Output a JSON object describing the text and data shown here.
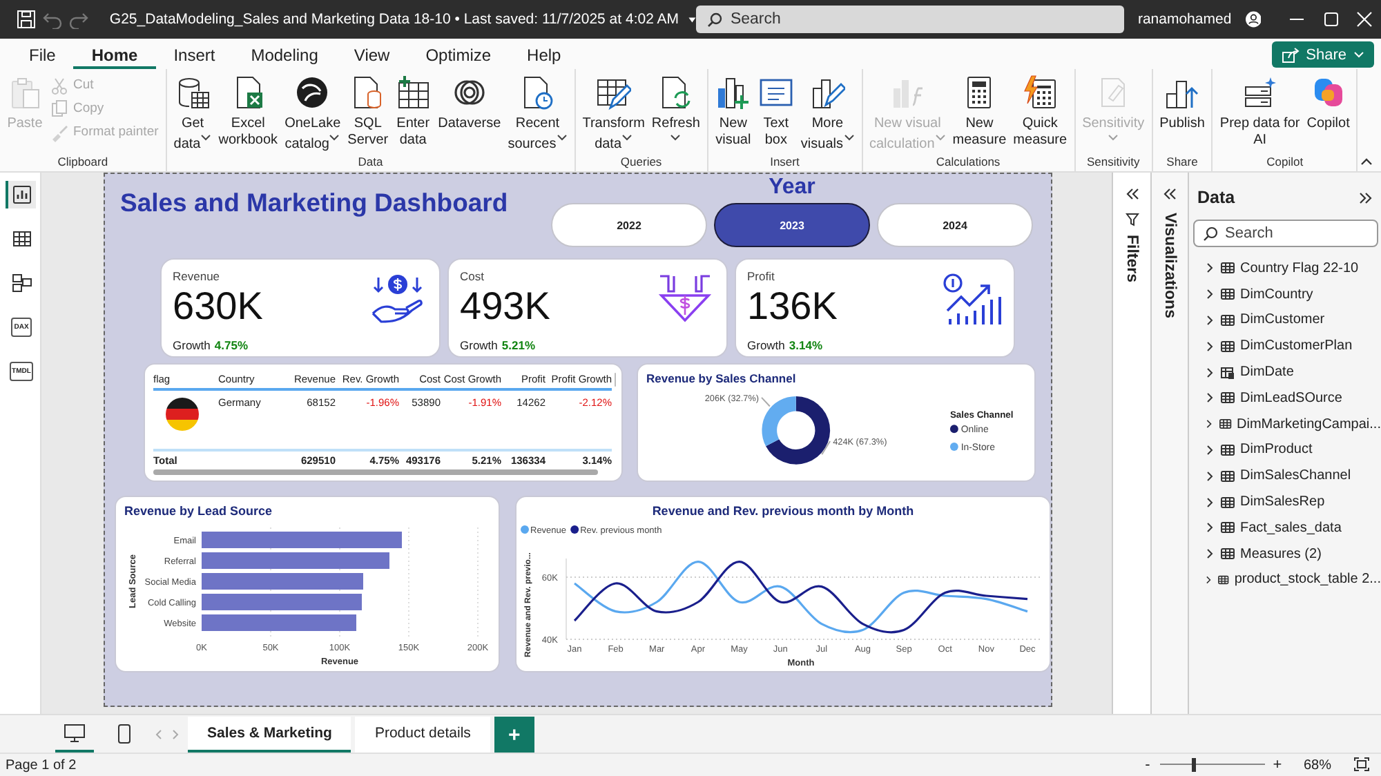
{
  "title_bar": {
    "document_title": "G25_DataModeling_Sales and Marketing Data 18-10 • Last saved: 11/7/2025 at 4:02 AM",
    "search": {
      "placeholder": "Search"
    },
    "user_name": "ranamohamed"
  },
  "menu_tabs": [
    {
      "label": "File",
      "selected": false
    },
    {
      "label": "Home",
      "selected": true
    },
    {
      "label": "Insert",
      "selected": false
    },
    {
      "label": "Modeling",
      "selected": false
    },
    {
      "label": "View",
      "selected": false
    },
    {
      "label": "Optimize",
      "selected": false
    },
    {
      "label": "Help",
      "selected": false
    }
  ],
  "share_button": {
    "label": "Share"
  },
  "ribbon_groups": [
    {
      "label": "Clipboard",
      "items": [
        {
          "kind": "large",
          "lines": [
            "Paste"
          ],
          "dropdown": false,
          "disabled": true
        },
        {
          "kind": "small",
          "lines": [
            "Cut"
          ],
          "dropdown": false,
          "disabled": true
        },
        {
          "kind": "small",
          "lines": [
            "Copy"
          ],
          "dropdown": false,
          "disabled": true
        },
        {
          "kind": "small",
          "lines": [
            "Format painter"
          ],
          "dropdown": false,
          "disabled": true
        }
      ]
    },
    {
      "label": "Data",
      "items": [
        {
          "kind": "large",
          "lines": [
            "Get",
            "data"
          ],
          "dropdown": true,
          "disabled": false
        },
        {
          "kind": "large",
          "lines": [
            "Excel",
            "workbook"
          ],
          "dropdown": false,
          "disabled": false
        },
        {
          "kind": "large",
          "lines": [
            "OneLake",
            "catalog"
          ],
          "dropdown": true,
          "disabled": false
        },
        {
          "kind": "large",
          "lines": [
            "SQL",
            "Server"
          ],
          "dropdown": false,
          "disabled": false
        },
        {
          "kind": "large",
          "lines": [
            "Enter",
            "data"
          ],
          "dropdown": false,
          "disabled": false
        },
        {
          "kind": "large",
          "lines": [
            "Dataverse"
          ],
          "dropdown": false,
          "disabled": false
        },
        {
          "kind": "large",
          "lines": [
            "Recent",
            "sources"
          ],
          "dropdown": true,
          "disabled": false
        }
      ]
    },
    {
      "label": "Queries",
      "items": [
        {
          "kind": "large",
          "lines": [
            "Transform",
            "data"
          ],
          "dropdown": true,
          "disabled": false
        },
        {
          "kind": "large",
          "lines": [
            "Refresh"
          ],
          "dropdown": true,
          "disabled": false
        }
      ]
    },
    {
      "label": "Insert",
      "items": [
        {
          "kind": "large",
          "lines": [
            "New",
            "visual"
          ],
          "dropdown": false,
          "disabled": false
        },
        {
          "kind": "large",
          "lines": [
            "Text",
            "box"
          ],
          "dropdown": false,
          "disabled": false
        },
        {
          "kind": "large",
          "lines": [
            "More",
            "visuals"
          ],
          "dropdown": true,
          "disabled": false
        }
      ]
    },
    {
      "label": "Calculations",
      "items": [
        {
          "kind": "large",
          "lines": [
            "New visual",
            "calculation"
          ],
          "dropdown": true,
          "disabled": true
        },
        {
          "kind": "large",
          "lines": [
            "New",
            "measure"
          ],
          "dropdown": false,
          "disabled": false
        },
        {
          "kind": "large",
          "lines": [
            "Quick",
            "measure"
          ],
          "dropdown": false,
          "disabled": false
        }
      ]
    },
    {
      "label": "Sensitivity",
      "items": [
        {
          "kind": "large",
          "lines": [
            "Sensitivity"
          ],
          "dropdown": true,
          "disabled": true
        }
      ]
    },
    {
      "label": "Share",
      "items": [
        {
          "kind": "large",
          "lines": [
            "Publish"
          ],
          "dropdown": false,
          "disabled": false
        }
      ]
    },
    {
      "label": "Copilot",
      "items": [
        {
          "kind": "large",
          "lines": [
            "Prep data for",
            "AI"
          ],
          "dropdown": false,
          "disabled": false
        },
        {
          "kind": "large",
          "lines": [
            "Copilot"
          ],
          "dropdown": false,
          "disabled": false
        }
      ]
    }
  ],
  "left_nav": [
    {
      "kind": "report",
      "selected": true
    },
    {
      "kind": "table",
      "selected": false
    },
    {
      "kind": "model",
      "selected": false
    },
    {
      "kind": "dax",
      "label": "DAX",
      "selected": false
    },
    {
      "kind": "tmdl",
      "label": "TMDL",
      "selected": false
    }
  ],
  "report": {
    "title": "Sales and Marketing Dashboard",
    "year_slicer": {
      "title": "Year",
      "options": [
        {
          "label": "2022",
          "selected": false
        },
        {
          "label": "2023",
          "selected": true
        },
        {
          "label": "2024",
          "selected": false
        }
      ]
    },
    "kpi_cards": [
      {
        "label": "Revenue",
        "value": "630K",
        "growth_label": "Growth",
        "growth": "4.75%",
        "negative": false
      },
      {
        "label": "Cost",
        "value": "493K",
        "growth_label": "Growth",
        "growth": "5.21%",
        "negative": false
      },
      {
        "label": "Profit",
        "value": "136K",
        "growth_label": "Growth",
        "growth": "3.14%",
        "negative": false
      }
    ],
    "country_table": {
      "columns": [
        "flag",
        "Country",
        "Revenue",
        "Rev. Growth",
        "Cost",
        "Cost Growth",
        "Profit",
        "Profit Growth"
      ],
      "rows": [
        {
          "cells": [
            {
              "text": ""
            },
            {
              "text": "Germany"
            },
            {
              "text": "68152"
            },
            {
              "text": "-1.96%",
              "negative": true
            },
            {
              "text": "53890"
            },
            {
              "text": "-1.91%",
              "negative": true
            },
            {
              "text": "14262"
            },
            {
              "text": "-2.12%",
              "negative": true
            }
          ]
        }
      ],
      "total": {
        "cells": [
          {
            "text": "Total"
          },
          {
            "text": ""
          },
          {
            "text": "629510"
          },
          {
            "text": "4.75%",
            "negative": false
          },
          {
            "text": "493176"
          },
          {
            "text": "5.21%",
            "negative": false
          },
          {
            "text": "136334"
          },
          {
            "text": "3.14%",
            "negative": false
          }
        ]
      }
    },
    "sales_channel_chart": {
      "title": "Revenue by Sales Channel",
      "legend_title": "Sales Channel",
      "slice_colors": [
        {
          "color": "#1b1f6e"
        },
        {
          "color": "#62acf0"
        }
      ],
      "chart_data": {
        "type": "donut",
        "categories": [
          "Online",
          "In-Store"
        ],
        "values": [
          67.3,
          32.7
        ],
        "value_labels": [
          "424K (67.3%)",
          "206K (32.7%)"
        ],
        "legend": "right"
      }
    },
    "lead_source_chart": {
      "title": "Revenue by Lead Source",
      "chart_data": {
        "type": "bar",
        "orientation": "horizontal",
        "xlabel": "Revenue",
        "ylabel": "Lead Source",
        "categories": [
          "Email",
          "Referral",
          "Social Media",
          "Cold Calling",
          "Website"
        ],
        "values": [
          145000,
          136000,
          117000,
          116000,
          112000
        ],
        "xlim": [
          0,
          200000
        ],
        "xticks": [
          {
            "value": 0,
            "label": "0K"
          },
          {
            "value": 50000,
            "label": "50K"
          },
          {
            "value": 100000,
            "label": "100K"
          },
          {
            "value": 150000,
            "label": "150K"
          },
          {
            "value": 200000,
            "label": "200K"
          }
        ],
        "grid": true
      }
    },
    "monthly_revenue_chart": {
      "title": "Revenue and Rev. previous month by Month",
      "chart_data": {
        "type": "line",
        "xlabel": "Month",
        "ylabel": "Revenue and Rev. previo...",
        "categories": [
          "Jan",
          "Feb",
          "Mar",
          "Apr",
          "May",
          "Jun",
          "Jul",
          "Aug",
          "Sep",
          "Oct",
          "Nov",
          "Dec"
        ],
        "series": [
          {
            "name": "Revenue",
            "color": "#5aa8ef",
            "values": [
              58000,
              49000,
              52000,
              65000,
              52000,
              57000,
              45000,
              43000,
              55000,
              54000,
              53000,
              49000
            ]
          },
          {
            "name": "Rev. previous month",
            "color": "#1a1f8c",
            "values": [
              46000,
              58000,
              49000,
              52000,
              65000,
              52000,
              57000,
              45000,
              43000,
              55000,
              54000,
              53000
            ]
          }
        ],
        "ylim": [
          40000,
          66000
        ],
        "yticks": [
          {
            "value": 40000,
            "label": "40K"
          },
          {
            "value": 60000,
            "label": "60K"
          }
        ],
        "grid": true,
        "legend": "top-left"
      }
    }
  },
  "filters_pane": {
    "label": "Filters"
  },
  "visualizations_pane": {
    "label": "Visualizations"
  },
  "data_pane": {
    "title": "Data",
    "search": {
      "placeholder": "Search"
    },
    "tables": [
      {
        "name": "Country Flag 22-10",
        "kind": "table",
        "expanded": false
      },
      {
        "name": "DimCountry",
        "kind": "table",
        "expanded": false
      },
      {
        "name": "DimCustomer",
        "kind": "table",
        "expanded": false
      },
      {
        "name": "DimCustomerPlan",
        "kind": "table",
        "expanded": false
      },
      {
        "name": "DimDate",
        "kind": "date_table",
        "expanded": false
      },
      {
        "name": "DimLeadSOurce",
        "kind": "table",
        "expanded": false
      },
      {
        "name": "DimMarketingCampai...",
        "kind": "table",
        "expanded": false
      },
      {
        "name": "DimProduct",
        "kind": "table",
        "expanded": false
      },
      {
        "name": "DimSalesChannel",
        "kind": "table",
        "expanded": false
      },
      {
        "name": "DimSalesRep",
        "kind": "table",
        "expanded": false
      },
      {
        "name": "Fact_sales_data",
        "kind": "table",
        "expanded": false
      },
      {
        "name": "Measures (2)",
        "kind": "table",
        "expanded": false
      },
      {
        "name": "product_stock_table 2...",
        "kind": "table",
        "expanded": false
      }
    ]
  },
  "page_bar": {
    "views": [
      {
        "kind": "desktop",
        "selected": true
      },
      {
        "kind": "phone",
        "selected": false
      }
    ],
    "tabs": [
      {
        "label": "Sales & Marketing",
        "selected": true
      },
      {
        "label": "Product details",
        "selected": false
      }
    ],
    "add_button": "+"
  },
  "status_bar": {
    "page": "Page 1 of 2",
    "zoom_out": "-",
    "zoom_in": "+",
    "zoom": "68%",
    "zoom_slider": {
      "level": 0.32
    }
  }
}
